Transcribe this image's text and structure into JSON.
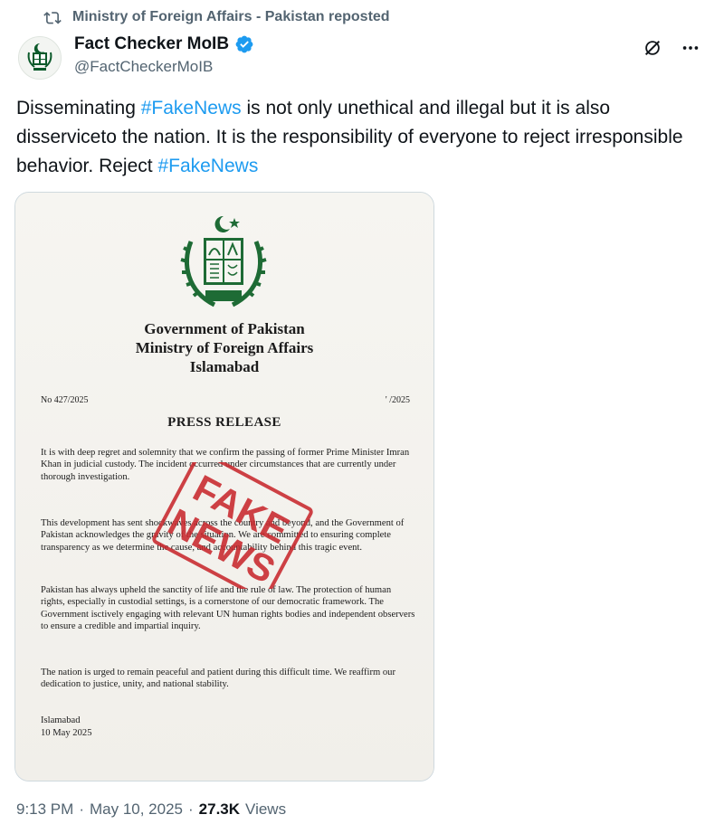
{
  "repost": {
    "text": "Ministry of Foreign Affairs - Pakistan reposted"
  },
  "author": {
    "display_name": "Fact Checker MoIB",
    "handle": "@FactCheckerMoIB"
  },
  "tweet": {
    "part1": "Disseminating ",
    "hashtag1": "#FakeNews",
    "part2": " is not only unethical and illegal but it is also disserviceto the nation. It is the responsibility of everyone to reject irresponsible behavior. Reject ",
    "hashtag2": "#FakeNews"
  },
  "document": {
    "gov_line1": "Government of Pakistan",
    "gov_line2": "Ministry of Foreign Affairs",
    "gov_line3": "Islamabad",
    "ref_no": "No 427/2025",
    "ref_date": "' /2025",
    "title": "PRESS RELEASE",
    "para1": "It is with deep regret and solemnity that we confirm the passing of former Prime Minister Imran Khan in judicial custody. The incident occurred under circumstances that are currently under thorough investigation.",
    "para2": "This development has sent shockwaves across the country and beyond, and the Government of Pakistan acknowledges the gravity of the situation. We are committed to ensuring complete transparency as we determine the cause, and accountability behind this tragic event.",
    "para3": "Pakistan has always upheld the sanctity of life and the rule of law. The protection of human rights, especially in custodial settings, is a cornerstone of our democratic framework. The Government isctively engaging with relevant UN human rights bodies and independent observers to ensure a credible and impartial inquiry.",
    "para4": "The nation is urged to remain peaceful and patient during this difficult time. We reaffirm our dedication to justice, unity, and national stability.",
    "sign_place": "Islamabad",
    "sign_date": "10 May 2025",
    "stamp_line1": "FAKE",
    "stamp_line2": "NEWS"
  },
  "footer": {
    "time": "9:13 PM",
    "sep1": "·",
    "date": "May 10, 2025",
    "sep2": "·",
    "views_count": "27.3K",
    "views_label": "Views"
  },
  "colors": {
    "accent": "#1d9bf0",
    "muted": "#536471",
    "stamp_red": "#c8282d"
  }
}
